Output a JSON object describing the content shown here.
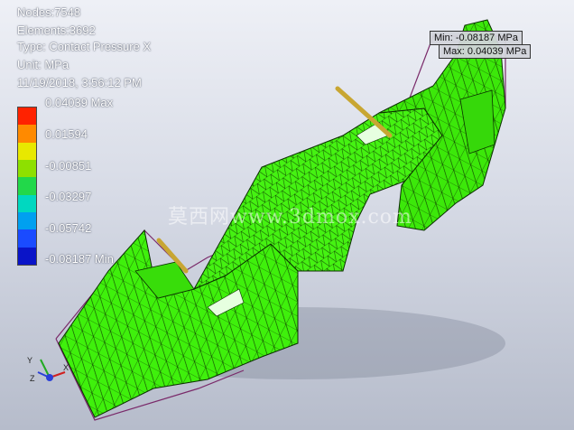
{
  "info": {
    "nodes": "Nodes:7548",
    "elements": "Elements:3692",
    "type": "Type: Contact Pressure X",
    "unit": "Unit: MPa",
    "timestamp": "11/19/2018, 3:56:12 PM"
  },
  "legend": {
    "labels": [
      "0.04039 Max",
      "0.01594",
      "-0.00851",
      "-0.03297",
      "-0.05742",
      "-0.08187 Min"
    ],
    "colors": [
      "#ff2200",
      "#ff8a00",
      "#e8e800",
      "#8ee000",
      "#22d84a",
      "#00d8c0",
      "#00a0f0",
      "#1a4bff",
      "#0a14c8"
    ]
  },
  "probes": {
    "min": "Min: -0.08187 MPa",
    "max": "Max: 0.04039 MPa"
  },
  "watermark": "莫西网www.3dmox.com",
  "colors": {
    "part": "#3ff00c",
    "mesh": "#0b3000",
    "outline": "#7a2a6a",
    "arrow": "#c8a632"
  },
  "triad": {
    "x": "X",
    "y": "Y",
    "z": "Z"
  }
}
